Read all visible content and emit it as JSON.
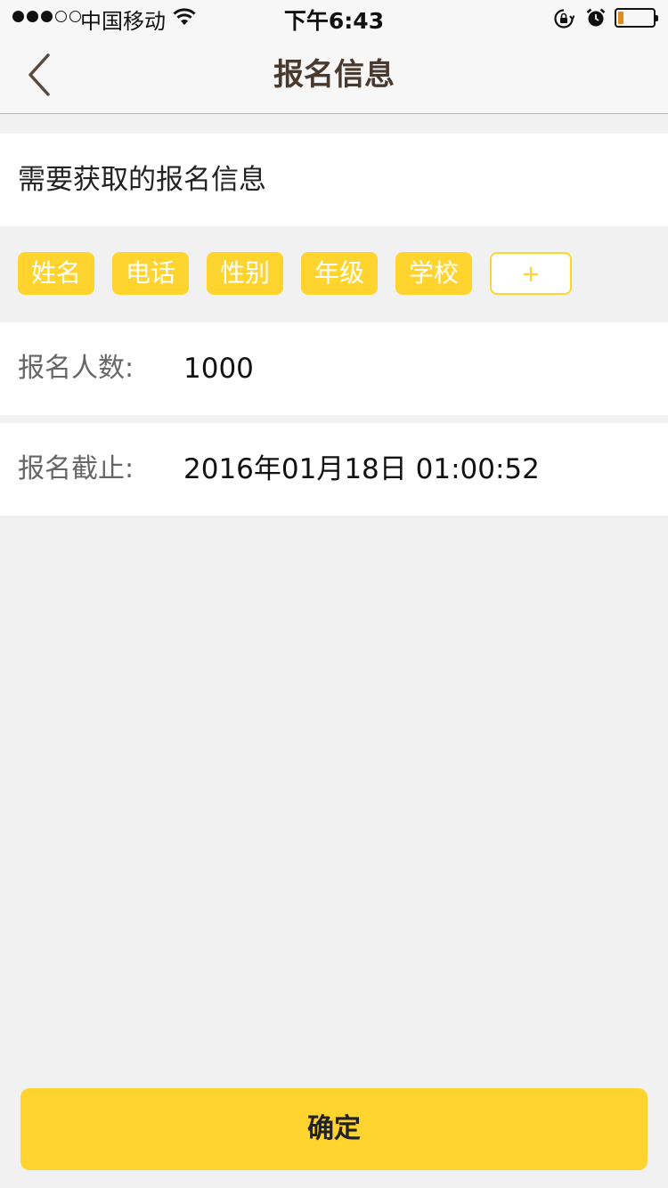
{
  "status_bar": {
    "carrier": "中国移动",
    "time": "下午6:43",
    "battery_level": 0.15,
    "signal_bars_filled": 3,
    "signal_bars_total": 5
  },
  "nav": {
    "title": "报名信息",
    "back_icon": "chevron-left-icon"
  },
  "section": {
    "title": "需要获取的报名信息"
  },
  "tags": {
    "items": [
      "姓名",
      "电话",
      "性别",
      "年级",
      "学校"
    ],
    "add_label": "+"
  },
  "fields": {
    "count_label": "报名人数:",
    "count_value": "1000",
    "deadline_label": "报名截止:",
    "deadline_value": "2016年01月18日 01:00:52"
  },
  "actions": {
    "confirm_label": "确定"
  },
  "colors": {
    "accent": "#ffd42e",
    "background": "#f1f1f1",
    "title_text": "#4a3a2e"
  }
}
